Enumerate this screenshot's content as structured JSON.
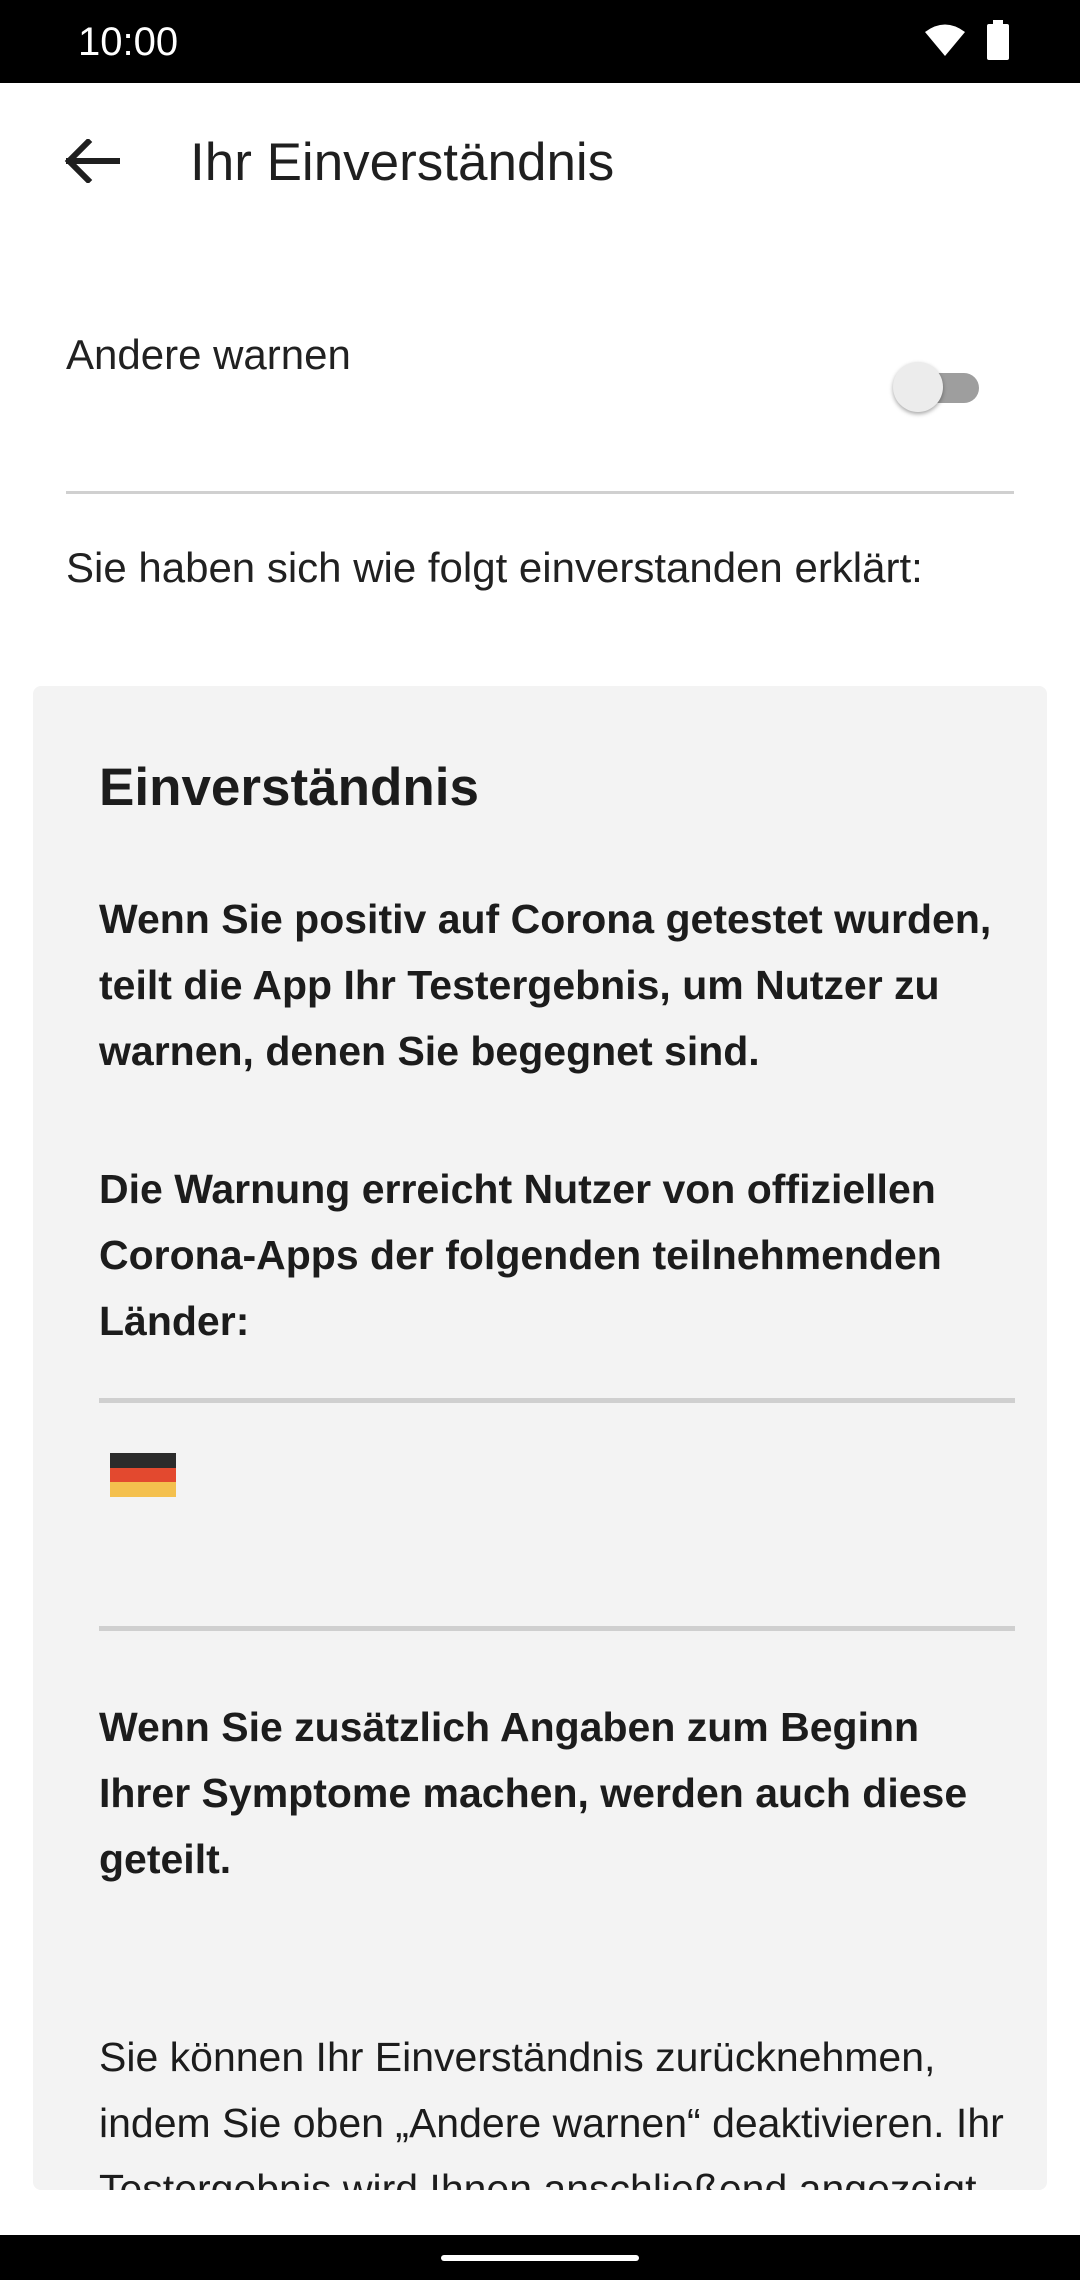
{
  "status_bar": {
    "time": "10:00",
    "icons": [
      "wifi-icon",
      "battery-icon"
    ]
  },
  "app_bar": {
    "back_icon": "arrow-left-icon",
    "title": "Ihr Einverständnis"
  },
  "warn_others": {
    "label": "Andere warnen",
    "switch_state": "off"
  },
  "consent_intro": "Sie haben sich wie folgt einverstanden erklärt:",
  "card": {
    "title": "Einverständnis",
    "paragraph1": "Wenn Sie positiv auf Corona getestet wurden, teilt die App Ihr Testergebnis, um Nutzer zu warnen, denen Sie begegnet sind.",
    "paragraph2": "Die Warnung erreicht Nutzer von offiziellen Corona-Apps der folgenden teilnehmenden Länder:",
    "countries": [
      {
        "flag": "germany-flag",
        "colors": [
          "#2b2b2b",
          "#e3492f",
          "#f4c04e"
        ]
      }
    ],
    "paragraph3": "Wenn Sie zusätzlich Angaben zum Beginn Ihrer Symptome machen, werden auch diese geteilt.",
    "paragraph4": "Sie können Ihr Einverständnis zurücknehmen, indem Sie oben „Andere warnen“ deaktivieren. Ihr Testergebnis wird Ihnen anschließend angezeigt."
  },
  "colors": {
    "card_background": "#f3f3f3",
    "text": "#1c1c1c",
    "divider": "#cfcfcf"
  }
}
